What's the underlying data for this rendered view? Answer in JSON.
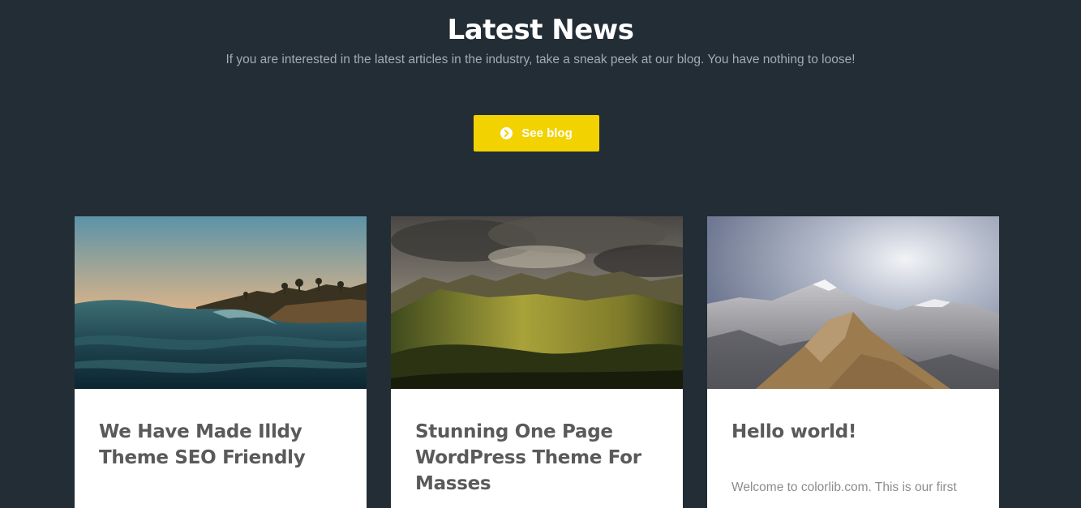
{
  "section": {
    "title": "Latest News",
    "subtitle": "If you are interested in the latest articles in the industry, take a sneak peek at our blog. You have nothing to loose!"
  },
  "cta": {
    "label": "See blog",
    "icon": "chevron-circle-right-icon",
    "color": "#f2d200"
  },
  "colors": {
    "background": "#232d36",
    "card_title": "#5a5a5a"
  },
  "posts": [
    {
      "title": "We Have Made Illdy Theme SEO Friendly",
      "excerpt": "",
      "image": "ocean-wave-coast-image"
    },
    {
      "title": "Stunning One Page WordPress Theme For Masses",
      "excerpt": "",
      "image": "mountain-valley-clouds-image"
    },
    {
      "title": "Hello world!",
      "excerpt": "Welcome to colorlib.com. This is our first",
      "image": "rocky-mountain-ridge-image"
    }
  ]
}
